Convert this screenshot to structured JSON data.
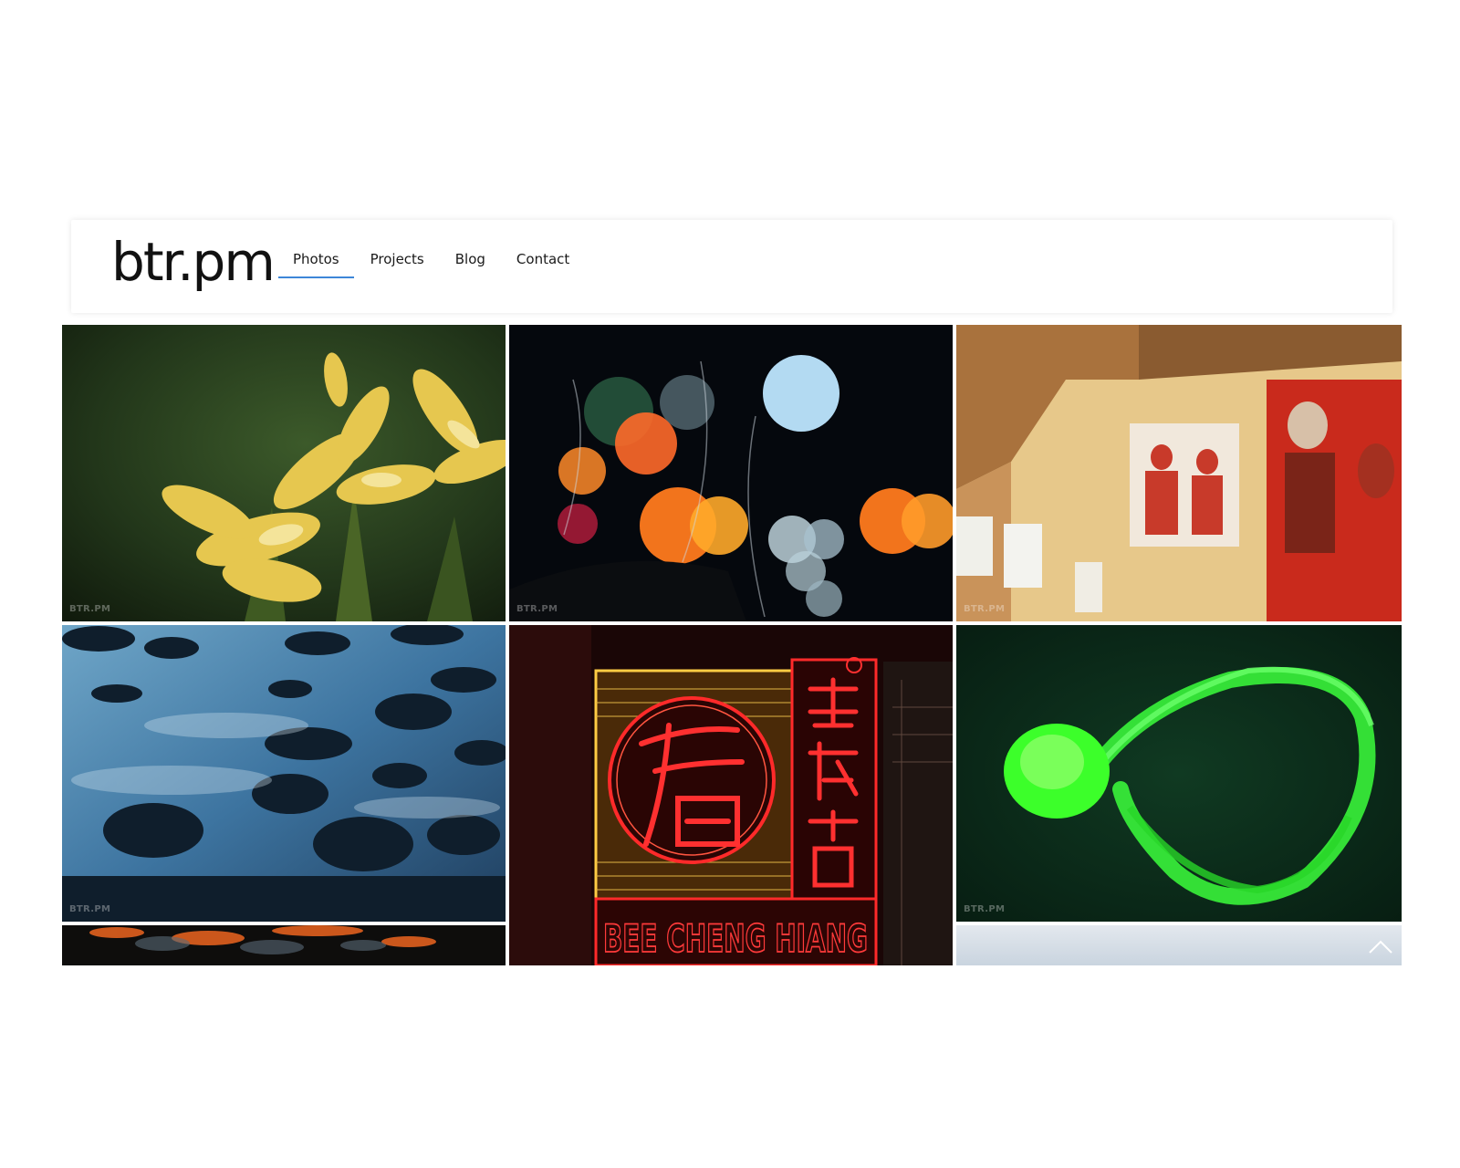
{
  "header": {
    "logo": "btr.pm",
    "nav": [
      {
        "label": "Photos",
        "active": true
      },
      {
        "label": "Projects",
        "active": false
      },
      {
        "label": "Blog",
        "active": false
      },
      {
        "label": "Contact",
        "active": false
      }
    ]
  },
  "gallery": {
    "watermark": "BTR.PM",
    "sign_text": "BEE CHENG HIANG",
    "tiles": [
      {
        "subject": "yellow-frangipani-flowers"
      },
      {
        "subject": "rainy-window-bokeh"
      },
      {
        "subject": "gallery-wall-paintings"
      },
      {
        "subject": "blue-river-rocks"
      },
      {
        "subject": "neon-sign"
      },
      {
        "subject": "green-jellyfish"
      },
      {
        "subject": "orange-embers"
      },
      {
        "subject": "pale-sky"
      }
    ]
  },
  "icons": {
    "back_to_top": "chevron-up-icon"
  },
  "colors": {
    "nav_active_underline": "#3d86d8",
    "logo": "#111111"
  }
}
